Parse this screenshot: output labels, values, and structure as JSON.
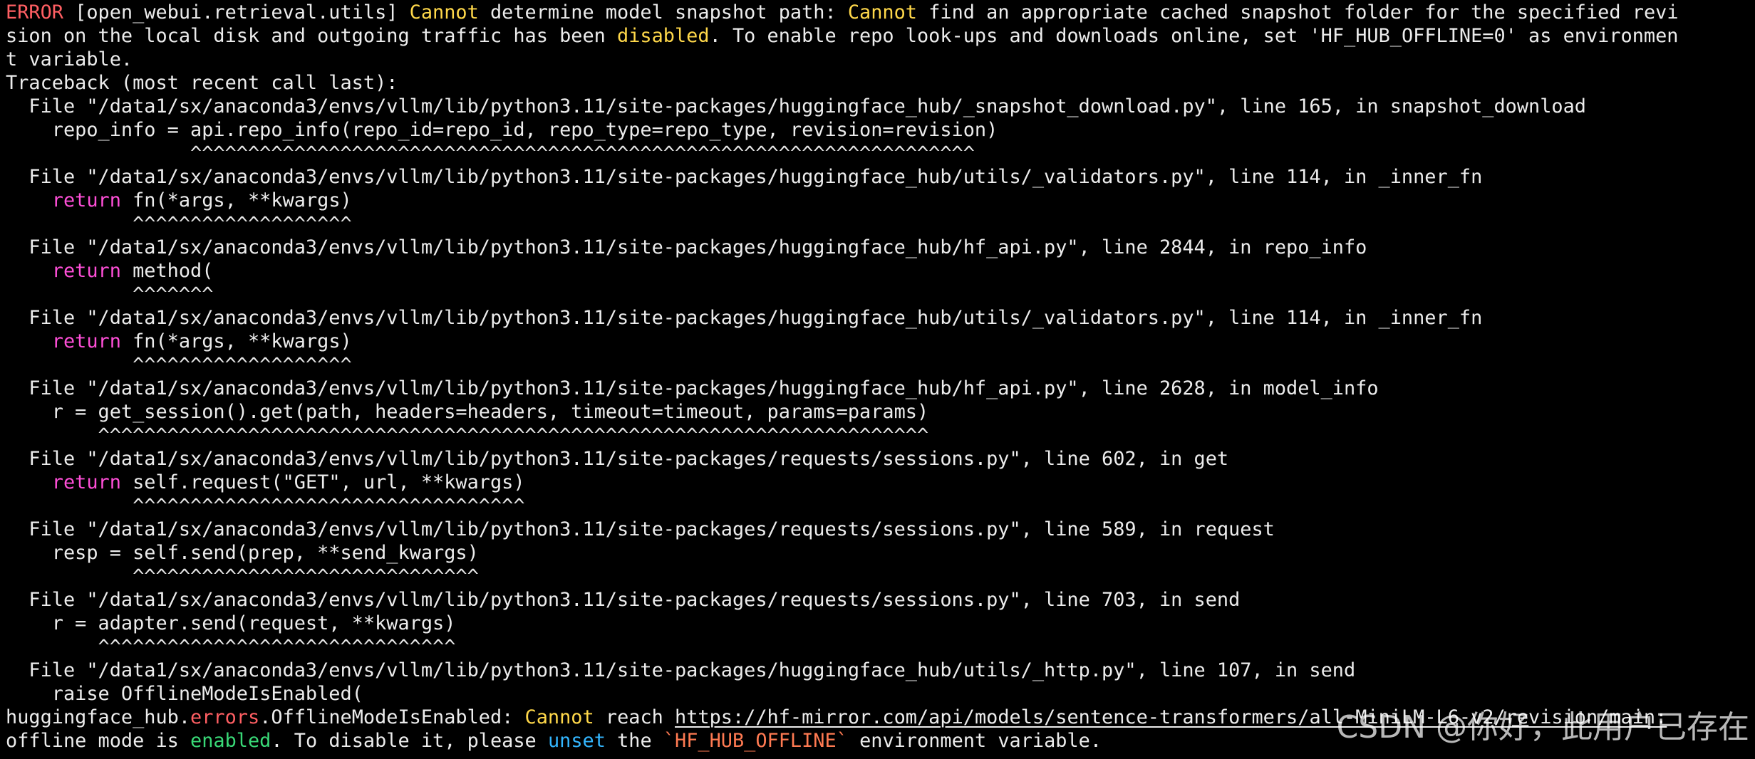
{
  "lines": [
    {
      "segments": [
        {
          "t": "ERROR",
          "c": "red"
        },
        {
          "t": " [open_webui.retrieval.utils] ",
          "c": "white"
        },
        {
          "t": "Cannot",
          "c": "yellow"
        },
        {
          "t": " determine model snapshot path: ",
          "c": "white"
        },
        {
          "t": "Cannot",
          "c": "yellow"
        },
        {
          "t": " find an appropriate cached snapshot folder for the specified revi",
          "c": "white"
        }
      ]
    },
    {
      "segments": [
        {
          "t": "sion on the local disk and outgoing traffic has been ",
          "c": "white"
        },
        {
          "t": "disabled",
          "c": "yellow"
        },
        {
          "t": ". To enable repo look-ups and downloads online, set 'HF_HUB_OFFLINE=0' as environmen",
          "c": "white"
        }
      ]
    },
    {
      "segments": [
        {
          "t": "t variable.",
          "c": "white"
        }
      ]
    },
    {
      "segments": [
        {
          "t": "Traceback (most recent call last):",
          "c": "white"
        }
      ]
    },
    {
      "segments": [
        {
          "t": "  File \"/data1/sx/anaconda3/envs/vllm/lib/python3.11/site-packages/huggingface_hub/_snapshot_download.py\", line 165, in snapshot_download",
          "c": "white"
        }
      ]
    },
    {
      "segments": [
        {
          "t": "    repo_info = api.repo_info(repo_id=repo_id, repo_type=repo_type, revision=revision)",
          "c": "white"
        }
      ]
    },
    {
      "segments": [
        {
          "t": "                ^^^^^^^^^^^^^^^^^^^^^^^^^^^^^^^^^^^^^^^^^^^^^^^^^^^^^^^^^^^^^^^^^^^^",
          "c": "carets"
        }
      ]
    },
    {
      "segments": [
        {
          "t": "  File \"/data1/sx/anaconda3/envs/vllm/lib/python3.11/site-packages/huggingface_hub/utils/_validators.py\", line 114, in _inner_fn",
          "c": "white"
        }
      ]
    },
    {
      "segments": [
        {
          "t": "    ",
          "c": "white"
        },
        {
          "t": "return",
          "c": "magenta"
        },
        {
          "t": " fn(*args, **kwargs)",
          "c": "white"
        }
      ]
    },
    {
      "segments": [
        {
          "t": "           ^^^^^^^^^^^^^^^^^^^",
          "c": "carets"
        }
      ]
    },
    {
      "segments": [
        {
          "t": "  File \"/data1/sx/anaconda3/envs/vllm/lib/python3.11/site-packages/huggingface_hub/hf_api.py\", line 2844, in repo_info",
          "c": "white"
        }
      ]
    },
    {
      "segments": [
        {
          "t": "    ",
          "c": "white"
        },
        {
          "t": "return",
          "c": "magenta"
        },
        {
          "t": " method(",
          "c": "white"
        }
      ]
    },
    {
      "segments": [
        {
          "t": "           ^^^^^^^",
          "c": "carets"
        }
      ]
    },
    {
      "segments": [
        {
          "t": "  File \"/data1/sx/anaconda3/envs/vllm/lib/python3.11/site-packages/huggingface_hub/utils/_validators.py\", line 114, in _inner_fn",
          "c": "white"
        }
      ]
    },
    {
      "segments": [
        {
          "t": "    ",
          "c": "white"
        },
        {
          "t": "return",
          "c": "magenta"
        },
        {
          "t": " fn(*args, **kwargs)",
          "c": "white"
        }
      ]
    },
    {
      "segments": [
        {
          "t": "           ^^^^^^^^^^^^^^^^^^^",
          "c": "carets"
        }
      ]
    },
    {
      "segments": [
        {
          "t": "  File \"/data1/sx/anaconda3/envs/vllm/lib/python3.11/site-packages/huggingface_hub/hf_api.py\", line 2628, in model_info",
          "c": "white"
        }
      ]
    },
    {
      "segments": [
        {
          "t": "    r = get_session().get(path, headers=headers, timeout=timeout, params=params)",
          "c": "white"
        }
      ]
    },
    {
      "segments": [
        {
          "t": "        ^^^^^^^^^^^^^^^^^^^^^^^^^^^^^^^^^^^^^^^^^^^^^^^^^^^^^^^^^^^^^^^^^^^^^^^^",
          "c": "carets"
        }
      ]
    },
    {
      "segments": [
        {
          "t": "  File \"/data1/sx/anaconda3/envs/vllm/lib/python3.11/site-packages/requests/sessions.py\", line 602, in get",
          "c": "white"
        }
      ]
    },
    {
      "segments": [
        {
          "t": "    ",
          "c": "white"
        },
        {
          "t": "return",
          "c": "magenta"
        },
        {
          "t": " self.request(\"GET\", url, **kwargs)",
          "c": "white"
        }
      ]
    },
    {
      "segments": [
        {
          "t": "           ^^^^^^^^^^^^^^^^^^^^^^^^^^^^^^^^^^",
          "c": "carets"
        }
      ]
    },
    {
      "segments": [
        {
          "t": "  File \"/data1/sx/anaconda3/envs/vllm/lib/python3.11/site-packages/requests/sessions.py\", line 589, in request",
          "c": "white"
        }
      ]
    },
    {
      "segments": [
        {
          "t": "    resp = self.send(prep, **send_kwargs)",
          "c": "white"
        }
      ]
    },
    {
      "segments": [
        {
          "t": "           ^^^^^^^^^^^^^^^^^^^^^^^^^^^^^^",
          "c": "carets"
        }
      ]
    },
    {
      "segments": [
        {
          "t": "  File \"/data1/sx/anaconda3/envs/vllm/lib/python3.11/site-packages/requests/sessions.py\", line 703, in send",
          "c": "white"
        }
      ]
    },
    {
      "segments": [
        {
          "t": "    r = adapter.send(request, **kwargs)",
          "c": "white"
        }
      ]
    },
    {
      "segments": [
        {
          "t": "        ^^^^^^^^^^^^^^^^^^^^^^^^^^^^^^^",
          "c": "carets"
        }
      ]
    },
    {
      "segments": [
        {
          "t": "  File \"/data1/sx/anaconda3/envs/vllm/lib/python3.11/site-packages/huggingface_hub/utils/_http.py\", line 107, in send",
          "c": "white"
        }
      ]
    },
    {
      "segments": [
        {
          "t": "    raise OfflineModeIsEnabled(",
          "c": "white"
        }
      ]
    },
    {
      "segments": [
        {
          "t": "huggingface_hub.",
          "c": "white"
        },
        {
          "t": "errors",
          "c": "red"
        },
        {
          "t": ".OfflineModeIsEnabled: ",
          "c": "white"
        },
        {
          "t": "Cannot",
          "c": "yellow"
        },
        {
          "t": " reach ",
          "c": "white"
        },
        {
          "t": "https://hf-mirror.com/api/models/sentence-transformers/all-MiniLM-L6-v2/revision/main:",
          "c": "link"
        }
      ]
    },
    {
      "segments": [
        {
          "t": "offline mode is ",
          "c": "white"
        },
        {
          "t": "enabled",
          "c": "green"
        },
        {
          "t": ". To disable it, please ",
          "c": "white"
        },
        {
          "t": "unset",
          "c": "blue"
        },
        {
          "t": " the ",
          "c": "white"
        },
        {
          "t": "`HF_HUB_OFFLINE`",
          "c": "orange"
        },
        {
          "t": " environment variable.",
          "c": "white"
        }
      ]
    }
  ],
  "watermark": "CSDN @你好，此用户已存在",
  "colors": {
    "background": "#000000",
    "white": "#ececec",
    "red": "#ff5f63",
    "yellow": "#ffd84a",
    "magenta": "#ff4fd8",
    "green": "#39d977",
    "blue": "#33b6ff",
    "orange": "#ff7a52"
  }
}
